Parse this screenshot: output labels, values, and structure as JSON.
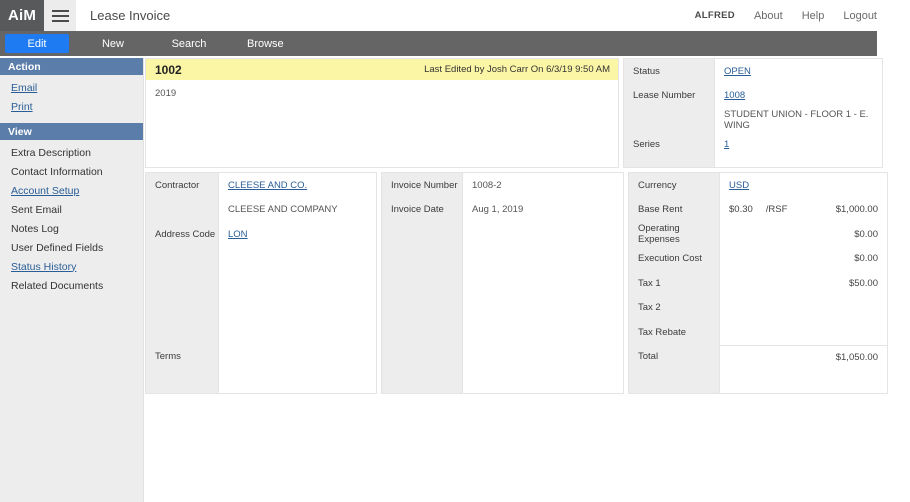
{
  "topbar": {
    "logo": "AiM",
    "menu_icon": "hamburger-icon",
    "app_title": "Lease Invoice",
    "user": "ALFRED",
    "links": [
      "About",
      "Help",
      "Logout"
    ]
  },
  "nav": {
    "tabs": [
      {
        "label": "Edit",
        "active": true
      },
      {
        "label": "New",
        "active": false
      },
      {
        "label": "Search",
        "active": false
      },
      {
        "label": "Browse",
        "active": false
      }
    ]
  },
  "sidebar": {
    "sections": [
      {
        "title": "Action",
        "items": [
          {
            "label": "Email",
            "link": true
          },
          {
            "label": "Print",
            "link": true
          }
        ]
      },
      {
        "title": "View",
        "items": [
          {
            "label": "Extra Description",
            "link": false
          },
          {
            "label": "Contact Information",
            "link": false
          },
          {
            "label": "Account Setup",
            "link": true
          },
          {
            "label": "Sent Email",
            "link": false
          },
          {
            "label": "Notes Log",
            "link": false
          },
          {
            "label": "User Defined Fields",
            "link": false
          },
          {
            "label": "Status History",
            "link": true
          },
          {
            "label": "Related Documents",
            "link": false
          }
        ]
      }
    ]
  },
  "summary": {
    "record_id": "1002",
    "last_edited": "Last Edited by Josh Carr On 6/3/19 9:50 AM",
    "description": "2019"
  },
  "status_panel": {
    "labels": {
      "status": "Status",
      "lease_number": "Lease Number",
      "series": "Series"
    },
    "values": {
      "status": "OPEN",
      "lease_number": "1008",
      "lease_description": "STUDENT UNION - FLOOR 1 - E. WING",
      "series": "1"
    }
  },
  "contractor_panel": {
    "labels": {
      "contractor": "Contractor",
      "address_code": "Address Code",
      "terms": "Terms"
    },
    "values": {
      "contractor_code": "CLEESE AND CO.",
      "contractor_name": "CLEESE AND COMPANY",
      "address_code": "LON",
      "terms": ""
    }
  },
  "invoice_panel": {
    "labels": {
      "invoice_number": "Invoice Number",
      "invoice_date": "Invoice Date"
    },
    "values": {
      "invoice_number": "1008-2",
      "invoice_date": "Aug 1, 2019"
    }
  },
  "money_panel": {
    "labels": {
      "currency": "Currency",
      "base_rent": "Base Rent",
      "operating_expenses": "Operating Expenses",
      "execution_cost": "Execution Cost",
      "tax_1": "Tax 1",
      "tax_2": "Tax 2",
      "tax_rebate": "Tax Rebate",
      "total": "Total"
    },
    "values": {
      "currency": "USD",
      "base_rent_rate": "$0.30",
      "base_rent_unit": "/RSF",
      "base_rent_amount": "$1,000.00",
      "operating_expenses": "$0.00",
      "execution_cost": "$0.00",
      "tax_1": "$50.00",
      "tax_2": "",
      "tax_rebate": "",
      "total": "$1,050.00"
    }
  },
  "colors": {
    "accent_blue": "#1f7bf2",
    "nav_gray": "#656565",
    "logo_gray": "#58595b",
    "section_blue": "#5b7da9",
    "highlight_yellow": "#fbf6a5",
    "link_blue": "#2a5d96",
    "sidebar_gray": "#ededed"
  }
}
